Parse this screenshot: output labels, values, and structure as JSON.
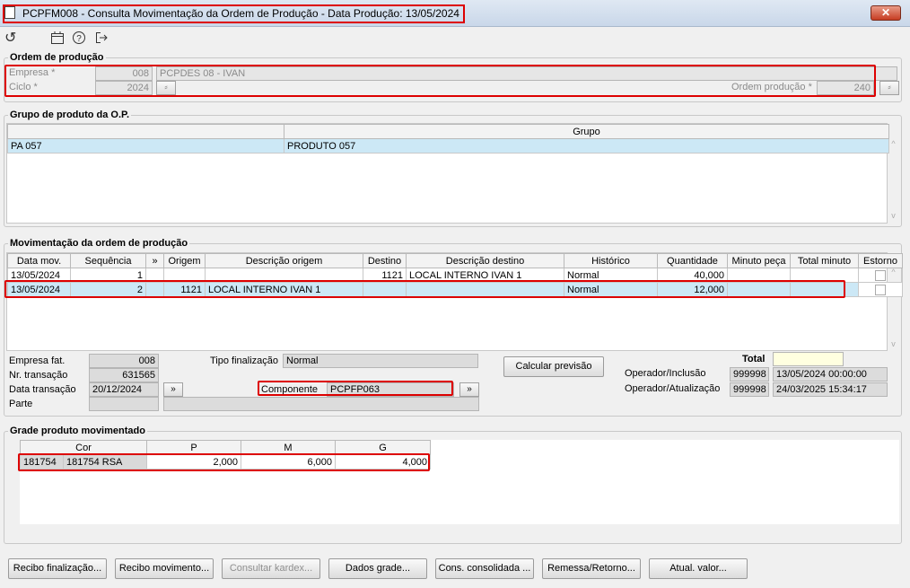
{
  "window": {
    "title": "PCPFM008 - Consulta Movimentação da Ordem de Produção - Data Produção: 13/05/2024",
    "close": "✕"
  },
  "toolbar": {
    "icons": [
      "undo-icon",
      "calendar-icon",
      "help-icon",
      "exit-icon"
    ]
  },
  "ordem": {
    "title": "Ordem de produção",
    "empresa_label": "Empresa *",
    "empresa_code": "008",
    "empresa_name": "PCPDES 08 - IVAN",
    "ciclo_label": "Ciclo *",
    "ciclo_value": "2024",
    "ordem_label": "Ordem produção *",
    "ordem_value": "240"
  },
  "grupo": {
    "title": "Grupo de produto da O.P.",
    "header": "Grupo",
    "rows": [
      {
        "code": "PA 057",
        "name": "PRODUTO 057"
      }
    ]
  },
  "mov": {
    "title": "Movimentação da ordem de produção",
    "headers": [
      "Data mov.",
      "Sequência",
      "»",
      "Origem",
      "Descrição origem",
      "Destino",
      "Descrição destino",
      "Histórico",
      "Quantidade",
      "Minuto peça",
      "Total minuto",
      "Estorno"
    ],
    "rows": [
      {
        "data": "13/05/2024",
        "seq": "1",
        "origem": "",
        "desc_origem": "",
        "destino": "1121",
        "desc_destino": "LOCAL INTERNO IVAN 1",
        "historico": "Normal",
        "quantidade": "40,000",
        "minuto": "",
        "total": ""
      },
      {
        "data": "13/05/2024",
        "seq": "2",
        "origem": "1121",
        "desc_origem": "LOCAL INTERNO IVAN 1",
        "destino": "",
        "desc_destino": "",
        "historico": "Normal",
        "quantidade": "12,000",
        "minuto": "",
        "total": ""
      }
    ],
    "empresa_fat_label": "Empresa fat.",
    "empresa_fat": "008",
    "nr_transacao_label": "Nr. transação",
    "nr_transacao": "631565",
    "data_transacao_label": "Data transação",
    "data_transacao": "20/12/2024",
    "parte_label": "Parte",
    "tipo_fin_label": "Tipo finalização",
    "tipo_fin": "Normal",
    "componente_label": "Componente",
    "componente": "PCPFP063",
    "calcular": "Calcular previsão",
    "total_label": "Total",
    "op_inclusao_label": "Operador/Inclusão",
    "op_inclusao_code": "999998",
    "op_inclusao_date": "13/05/2024 00:00:00",
    "op_atual_label": "Operador/Atualização",
    "op_atual_code": "999998",
    "op_atual_date": "24/03/2025 15:34:17"
  },
  "gradeprod": {
    "title": "Grade produto movimentado",
    "headers": [
      "Cor",
      "P",
      "M",
      "G"
    ],
    "row": {
      "code": "181754",
      "cor": "181754 RSA",
      "p": "2,000",
      "m": "6,000",
      "g": "4,000"
    }
  },
  "buttons": [
    "Recibo finalização...",
    "Recibo movimento...",
    "Consultar kardex...",
    "Dados grade...",
    "Cons. consolidada ...",
    "Remessa/Retorno...",
    "Atual. valor..."
  ]
}
